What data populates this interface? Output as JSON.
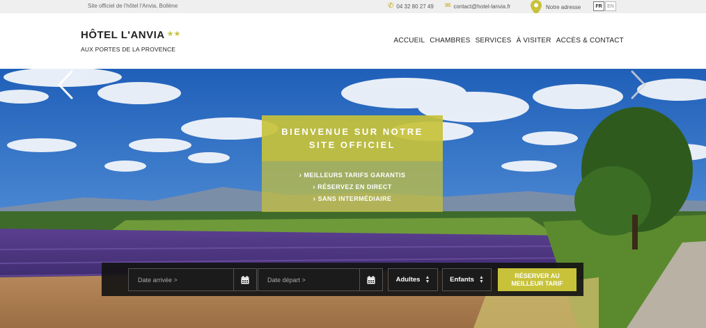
{
  "topbar": {
    "tagline": "Site officiel de l'hôtel l'Anvia, Bollène",
    "phone": "04 32 80 27 49",
    "email": "contact@hotel-lanvia.fr",
    "address_label": "Notre adresse",
    "languages": [
      "FR",
      "EN"
    ],
    "active_language": "FR"
  },
  "header": {
    "brand_name": "HÔTEL L'ANVIA",
    "brand_stars": "★★",
    "brand_subtitle": "AUX PORTES DE LA PROVENCE",
    "nav": [
      "ACCUEIL",
      "CHAMBRES",
      "SERVICES",
      "À VISITER",
      "ACCÈS & CONTACT"
    ]
  },
  "hero": {
    "promo_title_line1": "BIENVENUE SUR NOTRE",
    "promo_title_line2": "SITE OFFICIEL",
    "promo_points": [
      "MEILLEURS TARIFS GARANTIS",
      "RÉSERVEZ EN DIRECT",
      "SANS INTERMÉDIAIRE"
    ]
  },
  "booking": {
    "arrival_placeholder": "Date arrivée >",
    "departure_placeholder": "Date départ >",
    "adults_label": "Adultes",
    "children_label": "Enfants",
    "book_label_line1": "RÉSERVER AU",
    "book_label_line2": "MEILLEUR TARIF"
  },
  "colors": {
    "accent": "#c7c23a",
    "topbar_bg": "#efefef",
    "booking_bg": "#141414"
  },
  "icons": [
    "phone-icon",
    "mail-icon",
    "map-pin-icon",
    "calendar-icon",
    "chevron-left-icon",
    "chevron-right-icon",
    "updown-icon"
  ]
}
